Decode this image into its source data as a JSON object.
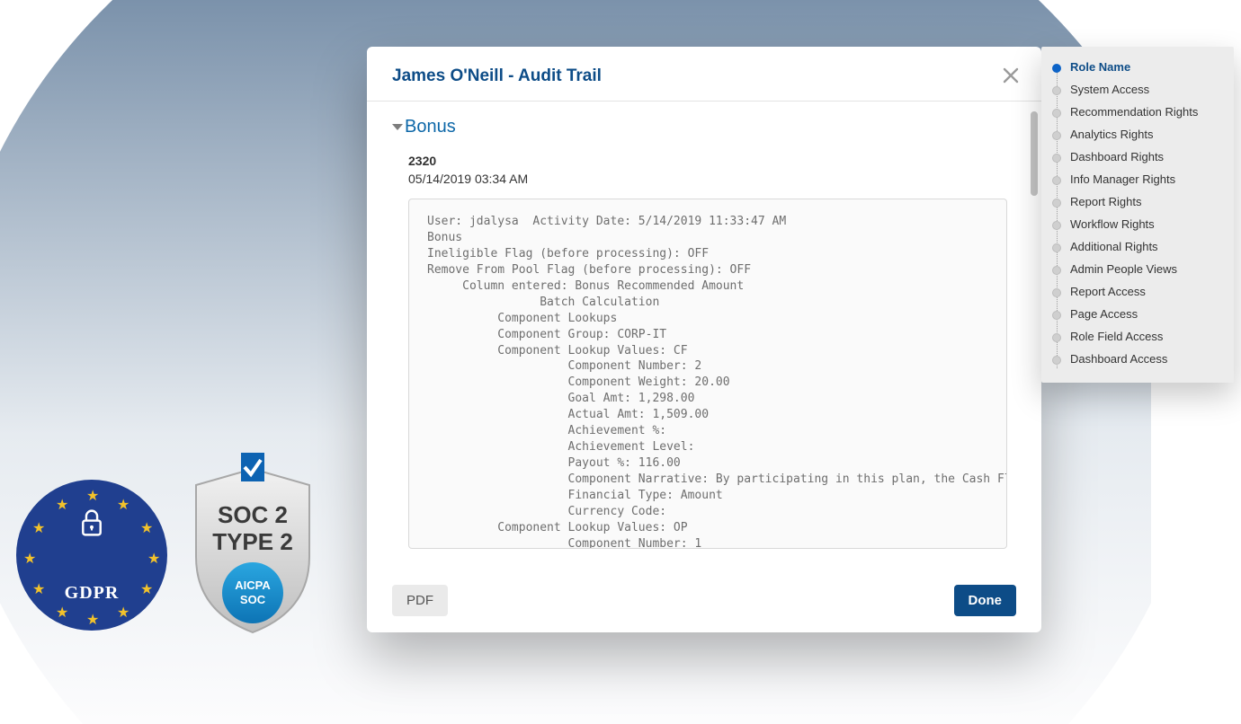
{
  "modal": {
    "title": "James O'Neill - Audit Trail",
    "section": "Bonus",
    "entry_id": "2320",
    "entry_timestamp": "05/14/2019 03:34 AM",
    "log_text": "User: jdalysa  Activity Date: 5/14/2019 11:33:47 AM\nBonus\nIneligible Flag (before processing): OFF\nRemove From Pool Flag (before processing): OFF\n     Column entered: Bonus Recommended Amount\n                Batch Calculation\n          Component Lookups\n          Component Group: CORP-IT\n          Component Lookup Values: CF\n                    Component Number: 2\n                    Component Weight: 20.00\n                    Goal Amt: 1,298.00\n                    Actual Amt: 1,509.00\n                    Achievement %:\n                    Achievement Level:\n                    Payout %: 116.00\n                    Component Narrative: By participating in this plan, the Cash Flow compo\n                    Financial Type: Amount\n                    Currency Code:\n          Component Lookup Values: OP\n                    Component Number: 1",
    "pdf_label": "PDF",
    "done_label": "Done"
  },
  "nav": {
    "items": [
      "Role Name",
      "System Access",
      "Recommendation Rights",
      "Analytics Rights",
      "Dashboard Rights",
      "Info Manager Rights",
      "Report Rights",
      "Workflow Rights",
      "Additional Rights",
      "Admin People Views",
      "Report Access",
      "Page Access",
      "Role Field Access",
      "Dashboard Access"
    ],
    "active_index": 0
  },
  "badges": {
    "gdpr_label": "GDPR",
    "soc_line1": "SOC 2",
    "soc_line2": "TYPE 2",
    "soc_aicpa1": "AICPA",
    "soc_aicpa2": "SOC"
  }
}
